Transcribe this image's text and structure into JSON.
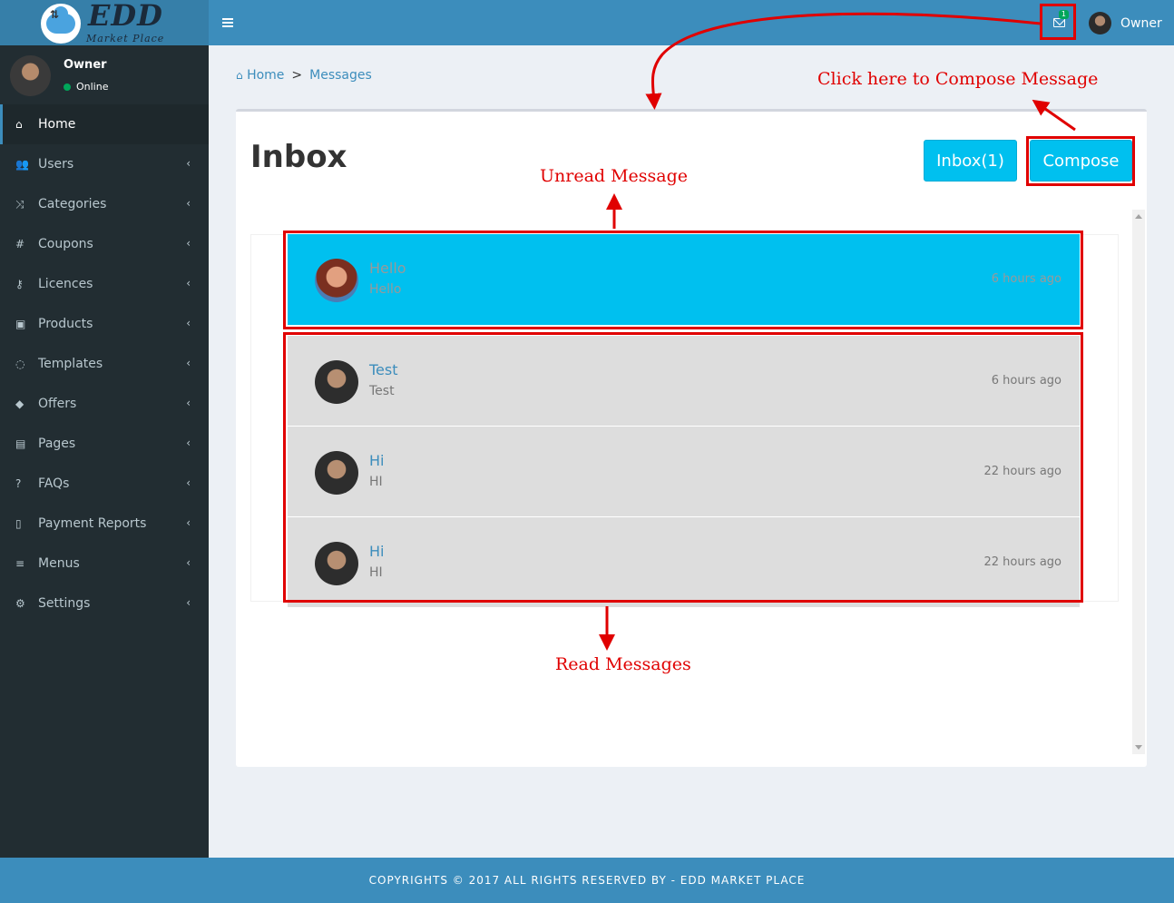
{
  "logo": {
    "title": "EDD",
    "subtitle": "Market Place"
  },
  "topbar": {
    "mail_badge": "1",
    "user_name": "Owner"
  },
  "sidebar": {
    "user": {
      "name": "Owner",
      "status": "Online"
    },
    "items": [
      {
        "label": "Home",
        "icon": "home-icon",
        "glyph": "⌂"
      },
      {
        "label": "Users",
        "icon": "users-icon",
        "glyph": "👥"
      },
      {
        "label": "Categories",
        "icon": "shuffle-icon",
        "glyph": "⤨"
      },
      {
        "label": "Coupons",
        "icon": "hashtag-icon",
        "glyph": "#"
      },
      {
        "label": "Licences",
        "icon": "key-icon",
        "glyph": "⚷"
      },
      {
        "label": "Products",
        "icon": "briefcase-icon",
        "glyph": "▣"
      },
      {
        "label": "Templates",
        "icon": "comment-icon",
        "glyph": "◌"
      },
      {
        "label": "Offers",
        "icon": "tags-icon",
        "glyph": "◆"
      },
      {
        "label": "Pages",
        "icon": "file-text-icon",
        "glyph": "▤"
      },
      {
        "label": "FAQs",
        "icon": "question-icon",
        "glyph": "?"
      },
      {
        "label": "Payment Reports",
        "icon": "file-icon",
        "glyph": "▯"
      },
      {
        "label": "Menus",
        "icon": "bars-icon",
        "glyph": "≡"
      },
      {
        "label": "Settings",
        "icon": "gear-icon",
        "glyph": "⚙"
      }
    ]
  },
  "breadcrumb": {
    "home": "Home",
    "separator": ">",
    "current": "Messages"
  },
  "main": {
    "title": "Inbox",
    "inbox_button": "Inbox(1)",
    "compose_button": "Compose",
    "messages": [
      {
        "subject": "Hello",
        "preview": "Hello",
        "time": "6 hours ago",
        "state": "unread"
      },
      {
        "subject": "Test",
        "preview": "Test",
        "time": "6 hours ago",
        "state": "read"
      },
      {
        "subject": "Hi",
        "preview": "HI",
        "time": "22 hours ago",
        "state": "read"
      },
      {
        "subject": "Hi",
        "preview": "HI",
        "time": "22 hours ago",
        "state": "read"
      }
    ]
  },
  "annotations": {
    "compose": "Click here to Compose Message",
    "unread": "Unread Message",
    "read": "Read Messages"
  },
  "footer": {
    "text": "COPYRIGHTS © 2017 ALL RIGHTS RESERVED BY - EDD MARKET PLACE"
  },
  "colors": {
    "topbar": "#3c8dbc",
    "sidebar": "#222d32",
    "accent": "#00c0ef",
    "annotation": "#e00000"
  }
}
